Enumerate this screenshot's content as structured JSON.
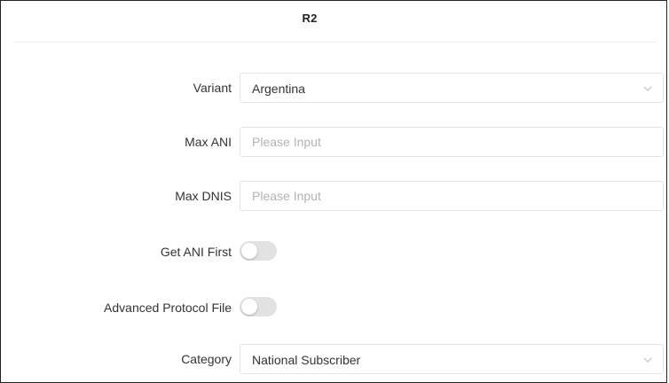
{
  "section": {
    "title": "R2"
  },
  "form": {
    "variant": {
      "label": "Variant",
      "value": "Argentina",
      "icon": "chevron-down-icon"
    },
    "max_ani": {
      "label": "Max ANI",
      "value": "",
      "placeholder": "Please Input"
    },
    "max_dnis": {
      "label": "Max DNIS",
      "value": "",
      "placeholder": "Please Input"
    },
    "get_ani_first": {
      "label": "Get ANI First",
      "enabled": false
    },
    "advanced_protocol_file": {
      "label": "Advanced Protocol File",
      "enabled": false
    },
    "category": {
      "label": "Category",
      "value": "National Subscriber",
      "icon": "chevron-down-icon"
    }
  },
  "colors": {
    "border": "#e4e4e4",
    "toggle_off": "#e2e2e2",
    "placeholder": "#b3b3b3",
    "text": "#333333"
  }
}
